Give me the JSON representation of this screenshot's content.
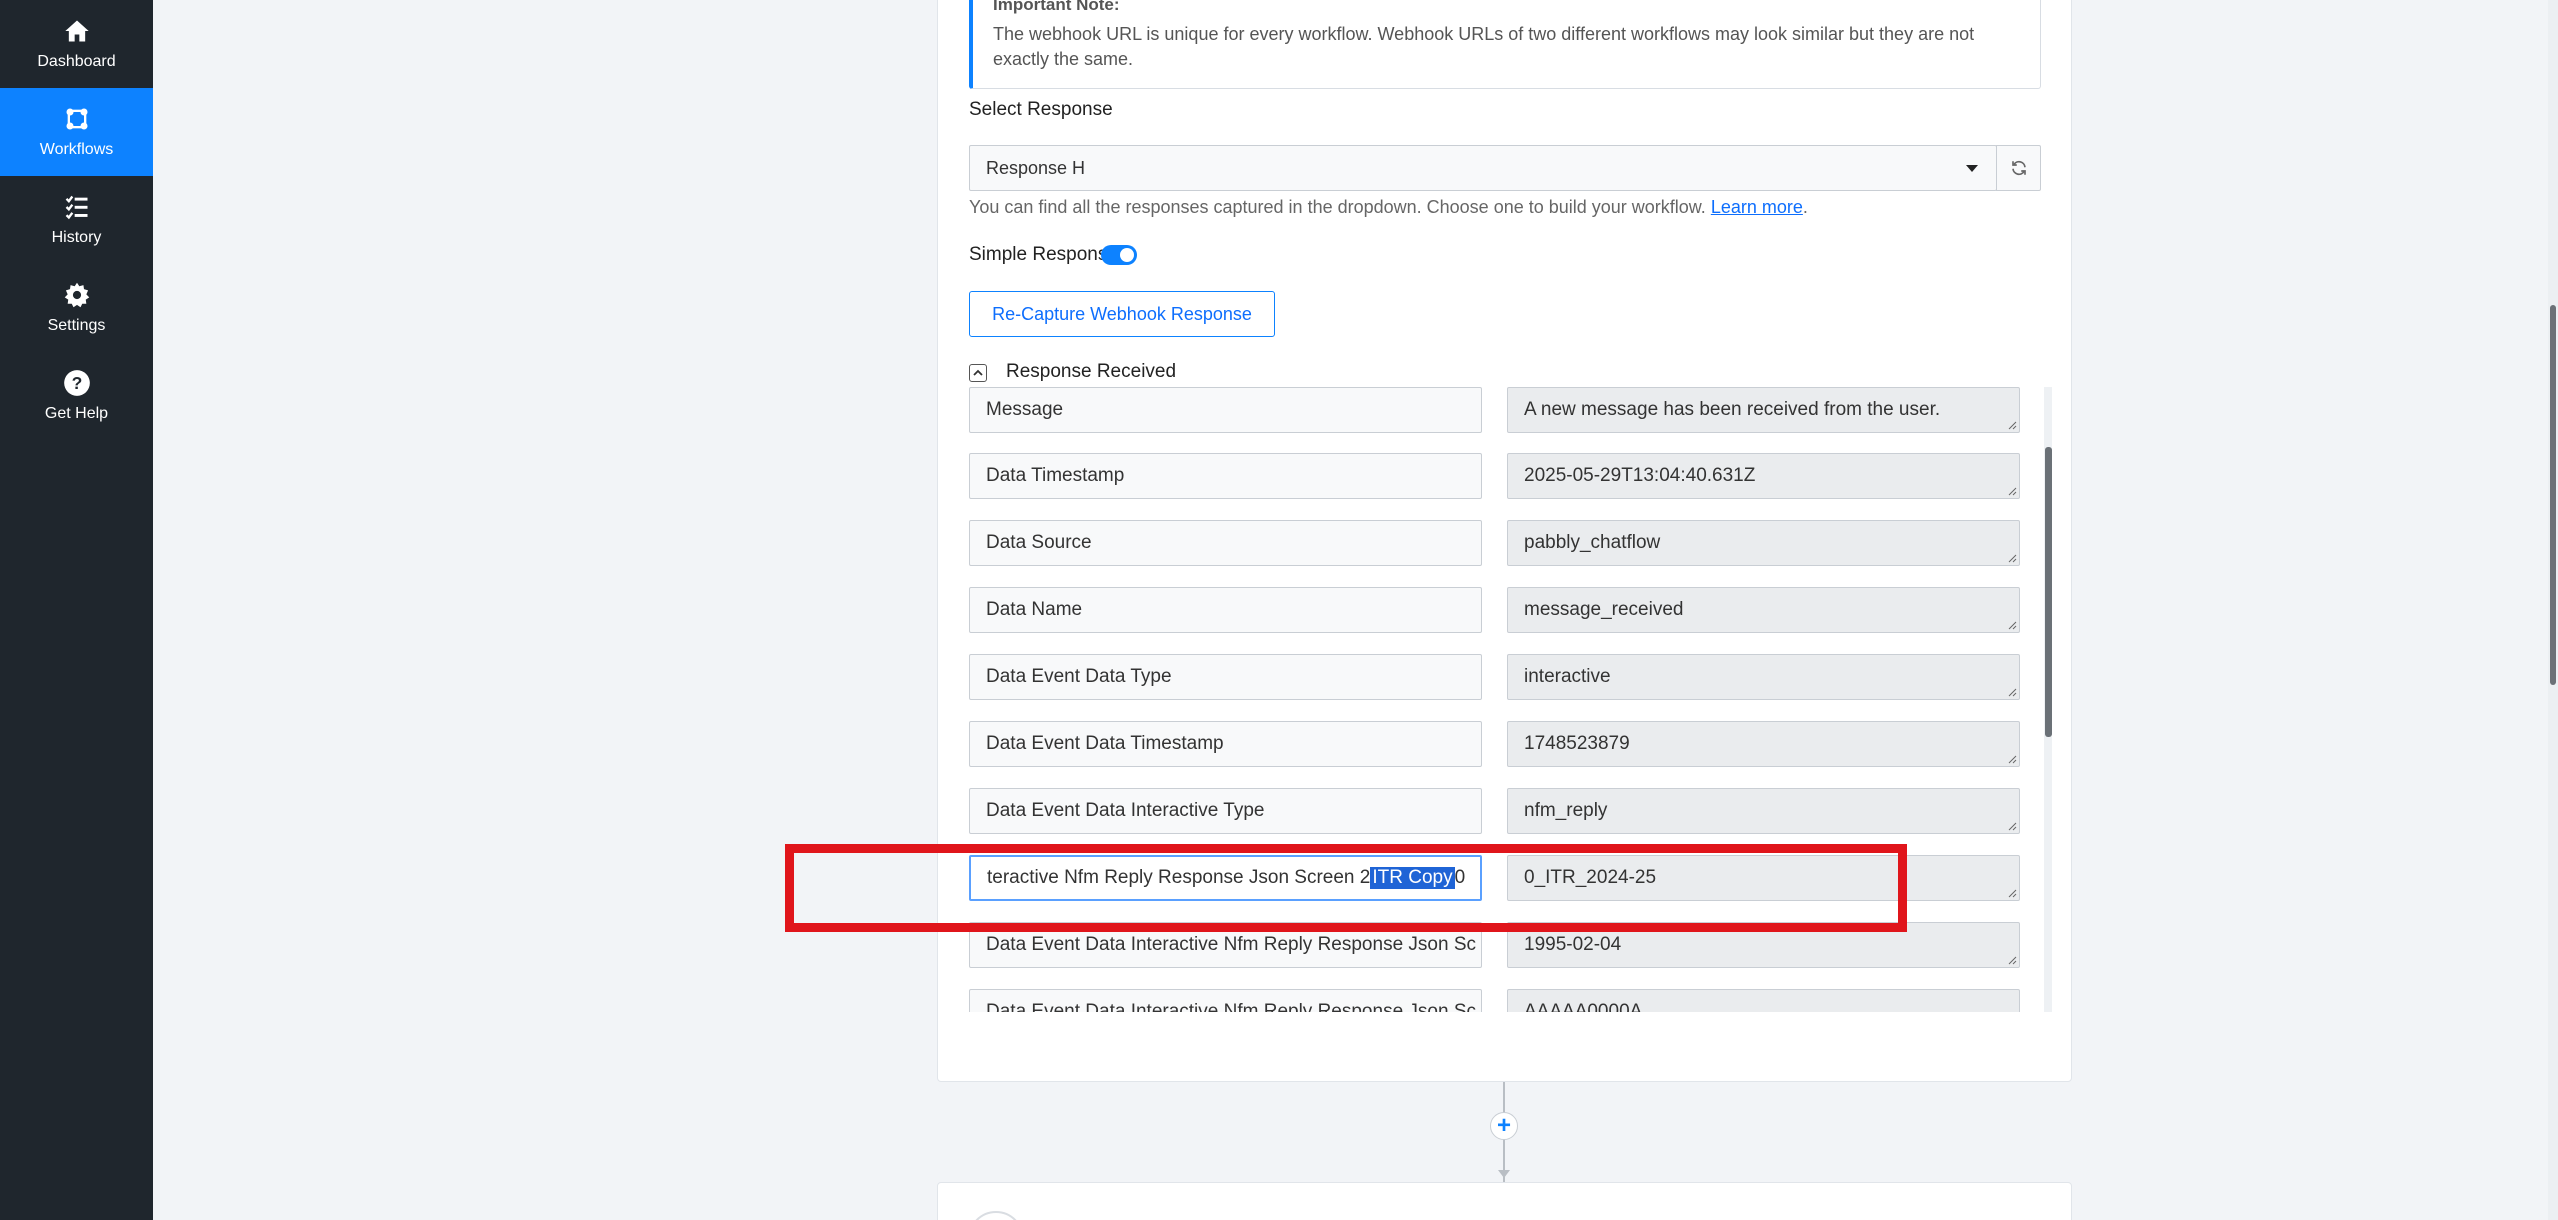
{
  "sidebar": {
    "items": [
      {
        "label": "Dashboard",
        "icon": "home-icon"
      },
      {
        "label": "Workflows",
        "icon": "workflow-icon",
        "active": true
      },
      {
        "label": "History",
        "icon": "history-icon"
      },
      {
        "label": "Settings",
        "icon": "gear-icon"
      },
      {
        "label": "Get Help",
        "icon": "question-icon"
      }
    ]
  },
  "note": {
    "title": "Important Note:",
    "text": "The webhook URL is unique for every workflow. Webhook URLs of two different workflows may look similar but they are not exactly the same."
  },
  "select_response": {
    "label": "Select Response",
    "value": "Response H",
    "helper_text": "You can find all the responses captured in the dropdown. Choose one to build your workflow.",
    "learn_more": "Learn more",
    "helper_suffix": "."
  },
  "simple_response": {
    "label": "Simple Response",
    "enabled": true
  },
  "recapture_label": "Re-Capture Webhook Response",
  "response_received_label": "Response Received",
  "rows": [
    {
      "key": "Message",
      "value": "A new message has been received from the user."
    },
    {
      "key": "Data Timestamp",
      "value": "2025-05-29T13:04:40.631Z"
    },
    {
      "key": "Data Source",
      "value": "pabbly_chatflow"
    },
    {
      "key": "Data Name",
      "value": "message_received"
    },
    {
      "key": "Data Event Data Type",
      "value": "interactive"
    },
    {
      "key": "Data Event Data Timestamp",
      "value": "1748523879"
    },
    {
      "key": "Data Event Data Interactive Type",
      "value": "nfm_reply"
    },
    {
      "key_prefix": "teractive Nfm Reply Response Json Screen 2",
      "key_selected": "ITR Copy",
      "key_suffix": "0",
      "value": "0_ITR_2024-25"
    },
    {
      "key": "Data Event Data Interactive Nfm Reply Response Json Sc",
      "value": "1995-02-04"
    },
    {
      "key": "Data Event Data Interactive Nfm Reply Response Json Sc",
      "value": "AAAAA0000A"
    }
  ],
  "colors": {
    "accent": "#0d82ff",
    "sidebar_bg": "#1f262d",
    "highlight": "#e0151b"
  }
}
